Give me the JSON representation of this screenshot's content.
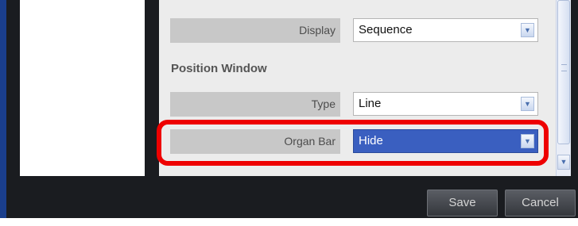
{
  "settings": {
    "display": {
      "label": "Display",
      "value": "Sequence"
    },
    "position_window": {
      "heading": "Position Window",
      "type": {
        "label": "Type",
        "value": "Line"
      },
      "organ_bar": {
        "label": "Organ Bar",
        "value": "Hide"
      }
    }
  },
  "footer": {
    "save_label": "Save",
    "cancel_label": "Cancel"
  },
  "icons": {
    "dropdown_arrow": "chevron-down-icon",
    "scroll_down": "scroll-down-icon"
  },
  "colors": {
    "highlight": "#ee0000",
    "selected": "#3a5fc0",
    "window": "#1a1c20"
  }
}
